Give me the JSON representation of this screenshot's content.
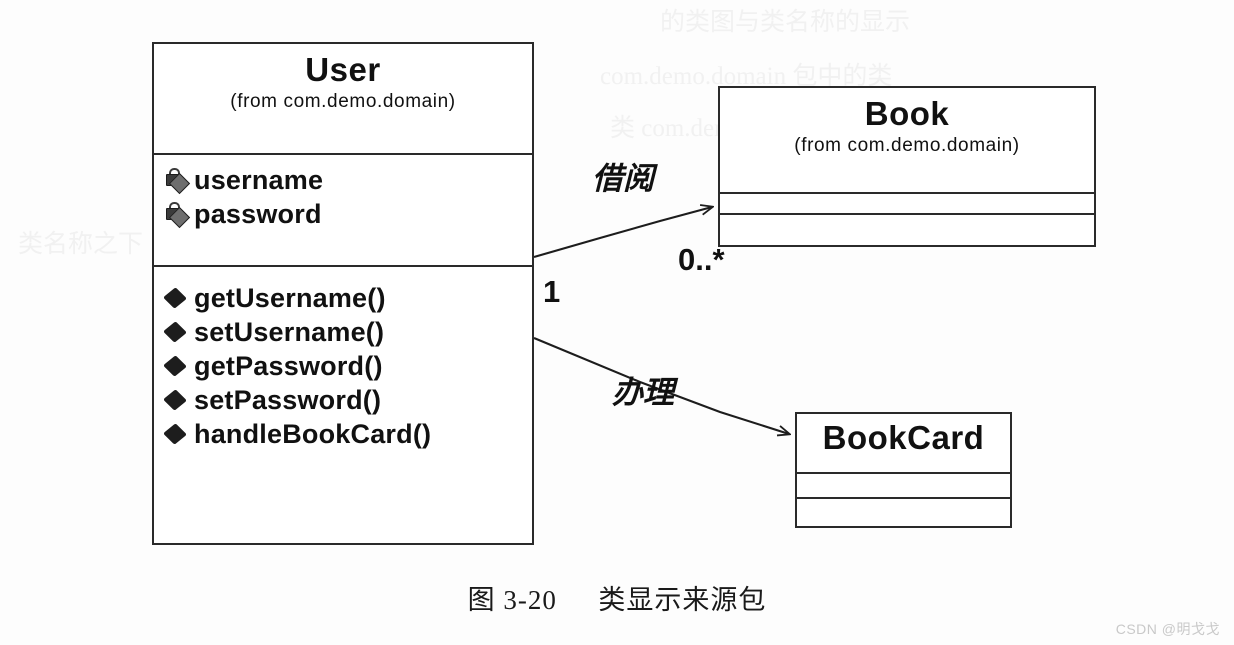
{
  "diagram": {
    "type": "uml-class-diagram",
    "caption_figure_number": "图 3-20",
    "caption_title": "类显示来源包",
    "watermark": "CSDN @明戈戈",
    "classes": [
      {
        "id": "user",
        "name": "User",
        "package": "(from com.demo.domain)",
        "attributes": [
          {
            "name": "username",
            "visibility": "private",
            "marker": "padlock-diamond-icon"
          },
          {
            "name": "password",
            "visibility": "private",
            "marker": "padlock-diamond-icon"
          }
        ],
        "operations": [
          {
            "name": "getUsername()",
            "visibility": "public",
            "marker": "filled-diamond-icon"
          },
          {
            "name": "setUsername()",
            "visibility": "public",
            "marker": "filled-diamond-icon"
          },
          {
            "name": "getPassword()",
            "visibility": "public",
            "marker": "filled-diamond-icon"
          },
          {
            "name": "setPassword()",
            "visibility": "public",
            "marker": "filled-diamond-icon"
          },
          {
            "name": "handleBookCard()",
            "visibility": "public",
            "marker": "filled-diamond-icon"
          }
        ]
      },
      {
        "id": "book",
        "name": "Book",
        "package": "(from com.demo.domain)",
        "attributes": [],
        "operations": []
      },
      {
        "id": "bookcard",
        "name": "BookCard",
        "package": "",
        "attributes": [],
        "operations": []
      }
    ],
    "associations": [
      {
        "id": "user-book",
        "label": "借阅",
        "source": "User",
        "target": "Book",
        "source_multiplicity": "1",
        "target_multiplicity": "0..*",
        "arrow": "open"
      },
      {
        "id": "user-bookcard",
        "label": "办理",
        "source": "User",
        "target": "BookCard",
        "source_multiplicity": "",
        "target_multiplicity": "",
        "arrow": "open"
      }
    ]
  },
  "colors": {
    "ink": "#1d1d1d",
    "paper": "#fdfdfd",
    "marker_private": "#3b3b3b",
    "marker_public": "#1d1d1d"
  },
  "bleed_text": {
    "line1": "的类图与类名称的显示",
    "line2": "com.demo.domain 包中的类",
    "line3": "类 com.demo.domain 包中",
    "line4": "类名称之下"
  }
}
